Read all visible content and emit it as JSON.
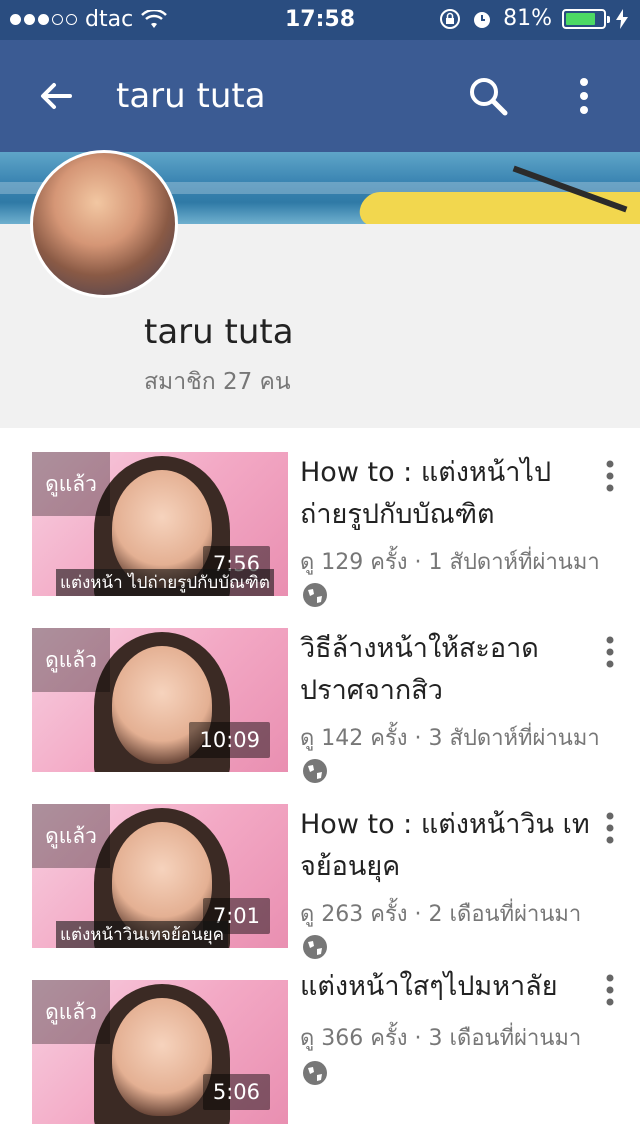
{
  "status_bar": {
    "signal_filled": 3,
    "signal_total": 5,
    "carrier": "dtac",
    "time": "17:58",
    "battery_percent": "81%",
    "battery_level": 0.81,
    "icons": [
      "wifi-icon",
      "rotation-lock-icon",
      "alarm-icon",
      "charging-icon"
    ]
  },
  "app_bar": {
    "title": "taru tuta",
    "icons": [
      "back-arrow-icon",
      "search-icon",
      "more-vert-icon"
    ]
  },
  "channel": {
    "name": "taru tuta",
    "subscribers": "สมาชิก 27 คน"
  },
  "videos": [
    {
      "watched": "ดูแล้ว",
      "duration": "7:56",
      "title": "How to : แต่งหน้าไป ถ่ายรูปกับบัณฑิต",
      "meta": "ดู 129 ครั้ง · 1 สัปดาห์ที่ผ่านมา",
      "caption": "แต่งหน้า ไปถ่ายรูปกับบัณฑิต"
    },
    {
      "watched": "ดูแล้ว",
      "duration": "10:09",
      "title": "วิธีล้างหน้าให้สะอาด ปราศจากสิว",
      "meta": "ดู 142 ครั้ง · 3 สัปดาห์ที่ผ่านมา",
      "caption": ""
    },
    {
      "watched": "ดูแล้ว",
      "duration": "7:01",
      "title": "How to : แต่งหน้าวิน เทจย้อนยุค",
      "meta": "ดู 263 ครั้ง · 2 เดือนที่ผ่านมา",
      "caption": "แต่งหน้าวินเทจย้อนยุค"
    },
    {
      "watched": "ดูแล้ว",
      "duration": "5:06",
      "title": "แต่งหน้าใสๆไปมหาลัย",
      "meta": "ดู 366 ครั้ง · 3 เดือนที่ผ่านมา",
      "caption": ""
    }
  ],
  "colors": {
    "status_bar": "#2a4d80",
    "app_bar": "#3b5b93",
    "battery": "#4cd964"
  }
}
